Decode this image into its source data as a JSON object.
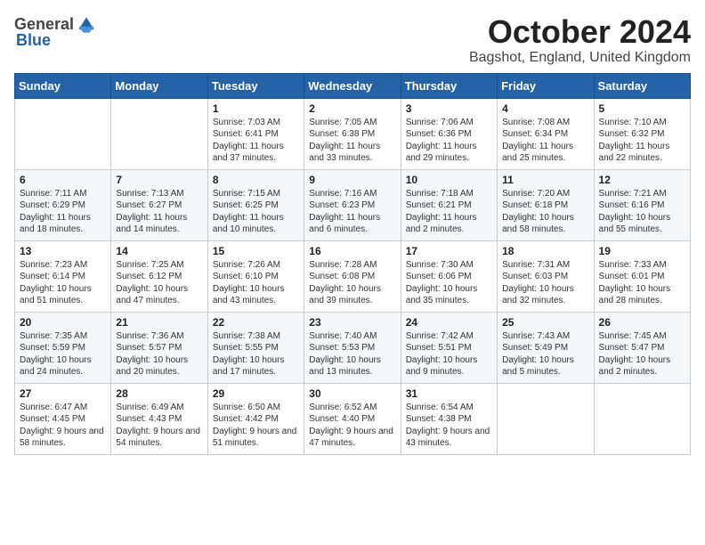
{
  "header": {
    "logo_general": "General",
    "logo_blue": "Blue",
    "month_title": "October 2024",
    "location": "Bagshot, England, United Kingdom"
  },
  "days_of_week": [
    "Sunday",
    "Monday",
    "Tuesday",
    "Wednesday",
    "Thursday",
    "Friday",
    "Saturday"
  ],
  "weeks": [
    [
      {
        "day": "",
        "info": ""
      },
      {
        "day": "",
        "info": ""
      },
      {
        "day": "1",
        "info": "Sunrise: 7:03 AM\nSunset: 6:41 PM\nDaylight: 11 hours and 37 minutes."
      },
      {
        "day": "2",
        "info": "Sunrise: 7:05 AM\nSunset: 6:38 PM\nDaylight: 11 hours and 33 minutes."
      },
      {
        "day": "3",
        "info": "Sunrise: 7:06 AM\nSunset: 6:36 PM\nDaylight: 11 hours and 29 minutes."
      },
      {
        "day": "4",
        "info": "Sunrise: 7:08 AM\nSunset: 6:34 PM\nDaylight: 11 hours and 25 minutes."
      },
      {
        "day": "5",
        "info": "Sunrise: 7:10 AM\nSunset: 6:32 PM\nDaylight: 11 hours and 22 minutes."
      }
    ],
    [
      {
        "day": "6",
        "info": "Sunrise: 7:11 AM\nSunset: 6:29 PM\nDaylight: 11 hours and 18 minutes."
      },
      {
        "day": "7",
        "info": "Sunrise: 7:13 AM\nSunset: 6:27 PM\nDaylight: 11 hours and 14 minutes."
      },
      {
        "day": "8",
        "info": "Sunrise: 7:15 AM\nSunset: 6:25 PM\nDaylight: 11 hours and 10 minutes."
      },
      {
        "day": "9",
        "info": "Sunrise: 7:16 AM\nSunset: 6:23 PM\nDaylight: 11 hours and 6 minutes."
      },
      {
        "day": "10",
        "info": "Sunrise: 7:18 AM\nSunset: 6:21 PM\nDaylight: 11 hours and 2 minutes."
      },
      {
        "day": "11",
        "info": "Sunrise: 7:20 AM\nSunset: 6:18 PM\nDaylight: 10 hours and 58 minutes."
      },
      {
        "day": "12",
        "info": "Sunrise: 7:21 AM\nSunset: 6:16 PM\nDaylight: 10 hours and 55 minutes."
      }
    ],
    [
      {
        "day": "13",
        "info": "Sunrise: 7:23 AM\nSunset: 6:14 PM\nDaylight: 10 hours and 51 minutes."
      },
      {
        "day": "14",
        "info": "Sunrise: 7:25 AM\nSunset: 6:12 PM\nDaylight: 10 hours and 47 minutes."
      },
      {
        "day": "15",
        "info": "Sunrise: 7:26 AM\nSunset: 6:10 PM\nDaylight: 10 hours and 43 minutes."
      },
      {
        "day": "16",
        "info": "Sunrise: 7:28 AM\nSunset: 6:08 PM\nDaylight: 10 hours and 39 minutes."
      },
      {
        "day": "17",
        "info": "Sunrise: 7:30 AM\nSunset: 6:06 PM\nDaylight: 10 hours and 35 minutes."
      },
      {
        "day": "18",
        "info": "Sunrise: 7:31 AM\nSunset: 6:03 PM\nDaylight: 10 hours and 32 minutes."
      },
      {
        "day": "19",
        "info": "Sunrise: 7:33 AM\nSunset: 6:01 PM\nDaylight: 10 hours and 28 minutes."
      }
    ],
    [
      {
        "day": "20",
        "info": "Sunrise: 7:35 AM\nSunset: 5:59 PM\nDaylight: 10 hours and 24 minutes."
      },
      {
        "day": "21",
        "info": "Sunrise: 7:36 AM\nSunset: 5:57 PM\nDaylight: 10 hours and 20 minutes."
      },
      {
        "day": "22",
        "info": "Sunrise: 7:38 AM\nSunset: 5:55 PM\nDaylight: 10 hours and 17 minutes."
      },
      {
        "day": "23",
        "info": "Sunrise: 7:40 AM\nSunset: 5:53 PM\nDaylight: 10 hours and 13 minutes."
      },
      {
        "day": "24",
        "info": "Sunrise: 7:42 AM\nSunset: 5:51 PM\nDaylight: 10 hours and 9 minutes."
      },
      {
        "day": "25",
        "info": "Sunrise: 7:43 AM\nSunset: 5:49 PM\nDaylight: 10 hours and 5 minutes."
      },
      {
        "day": "26",
        "info": "Sunrise: 7:45 AM\nSunset: 5:47 PM\nDaylight: 10 hours and 2 minutes."
      }
    ],
    [
      {
        "day": "27",
        "info": "Sunrise: 6:47 AM\nSunset: 4:45 PM\nDaylight: 9 hours and 58 minutes."
      },
      {
        "day": "28",
        "info": "Sunrise: 6:49 AM\nSunset: 4:43 PM\nDaylight: 9 hours and 54 minutes."
      },
      {
        "day": "29",
        "info": "Sunrise: 6:50 AM\nSunset: 4:42 PM\nDaylight: 9 hours and 51 minutes."
      },
      {
        "day": "30",
        "info": "Sunrise: 6:52 AM\nSunset: 4:40 PM\nDaylight: 9 hours and 47 minutes."
      },
      {
        "day": "31",
        "info": "Sunrise: 6:54 AM\nSunset: 4:38 PM\nDaylight: 9 hours and 43 minutes."
      },
      {
        "day": "",
        "info": ""
      },
      {
        "day": "",
        "info": ""
      }
    ]
  ]
}
